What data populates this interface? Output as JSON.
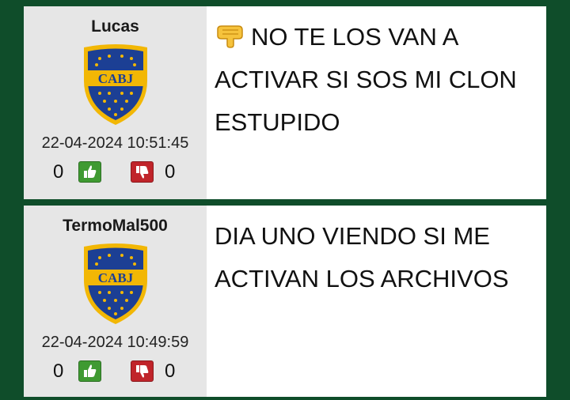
{
  "posts": [
    {
      "username": "Lucas",
      "avatar_label": "CABJ",
      "timestamp": "22-04-2024 10:51:45",
      "upvotes": "0",
      "downvotes": "0",
      "message_emoji": "point-down-icon",
      "message": "NO TE LOS VAN A ACTIVAR SI SOS MI CLON ESTUPIDO"
    },
    {
      "username": "TermoMal500",
      "avatar_label": "CABJ",
      "timestamp": "22-04-2024 10:49:59",
      "upvotes": "0",
      "downvotes": "0",
      "message": "DIA UNO VIENDO SI ME ACTIVAN LOS ARCHIVOS"
    }
  ],
  "colors": {
    "background": "#0f4d2a",
    "user_panel": "#e6e6e6",
    "upvote": "#3f9a32",
    "downvote": "#c0242a",
    "crest_blue": "#1c3f94",
    "crest_gold": "#f2b705"
  }
}
